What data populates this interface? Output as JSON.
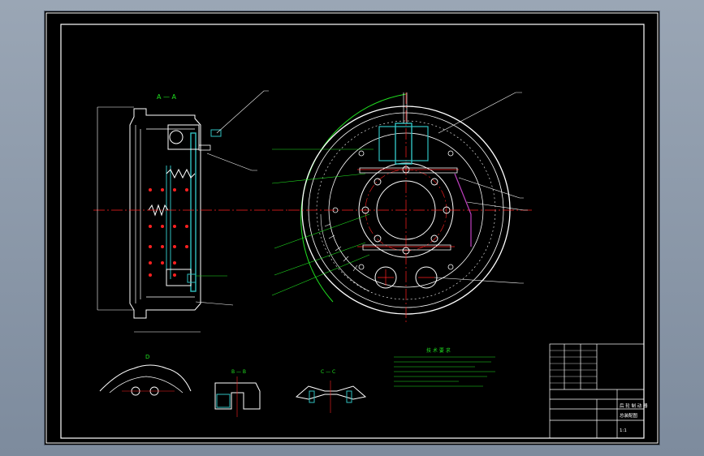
{
  "drawing": {
    "section_aa_label": "A — A",
    "section_bb_label": "B — B",
    "section_cc_label": "C — C",
    "detail_label": "D",
    "notes_title": "技 术 要 求",
    "title_block": {
      "drawing_title": "后 轮 制 动 器",
      "sheet_label": "总装配图",
      "scale_label": "1:1"
    }
  },
  "colors": {
    "background": "#000000",
    "frame": "#ffffff",
    "outline": "#ffffff",
    "centerline": "#ff2020",
    "dimension": "#20e020",
    "hidden": "#c040c0",
    "section_fill": "#30c0c0",
    "title_block": "#ffffff"
  }
}
